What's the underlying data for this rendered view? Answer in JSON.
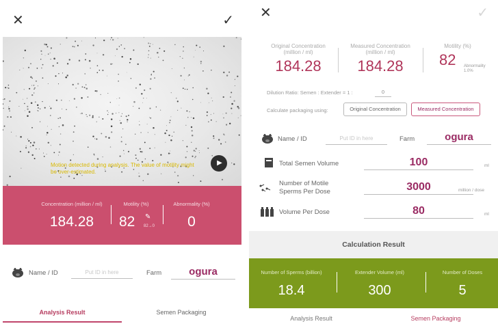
{
  "left": {
    "motion_warning": "Motion detected during analysis. The value of motility might be over-estimated.",
    "results": {
      "concentration_label": "Concentration (million / ml)",
      "concentration_value": "184.28",
      "motility_label": "Motility (%)",
      "motility_value": "82",
      "motility_sub": "82→0",
      "abnormality_label": "Abnormality (%)",
      "abnormality_value": "0"
    },
    "name_label": "Name / ID",
    "name_placeholder": "Put ID in here",
    "farm_label": "Farm",
    "farm_value": "ogura",
    "tabs": [
      "Analysis Result",
      "Semen Packaging"
    ]
  },
  "right": {
    "original_concentration_label": "Original Concentration (million / ml)",
    "original_concentration_value": "184.28",
    "measured_concentration_label": "Measured Concentration (million / ml)",
    "measured_concentration_value": "184.28",
    "motility_label": "Motility (%)",
    "motility_value": "82",
    "abnormality_small": "Abnormality 1.0%",
    "dilution_label": "Dilution Ratio: Semen : Extender = 1 :",
    "dilution_value": "0",
    "calc_using_label": "Calculate packaging using:",
    "option_original": "Original Concentration",
    "option_measured": "Measured Concentration",
    "name_label": "Name / ID",
    "name_placeholder": "Put ID in here",
    "farm_label": "Farm",
    "farm_value": "ogura",
    "total_volume_label": "Total Semen Volume",
    "total_volume_value": "100",
    "total_volume_unit": "ml",
    "motile_sperms_label_1": "Number of Motile",
    "motile_sperms_label_2": "Sperms Per Dose",
    "motile_sperms_value": "3000",
    "motile_sperms_unit": "million / dose",
    "volume_per_dose_label": "Volume Per Dose",
    "volume_per_dose_value": "80",
    "volume_per_dose_unit": "ml",
    "calc_result_header": "Calculation Result",
    "sperms_label": "Number of Sperms (billion)",
    "sperms_value": "18.4",
    "extender_label": "Extender Volume (ml)",
    "extender_value": "300",
    "doses_label": "Number of Doses",
    "doses_value": "5",
    "tabs": [
      "Analysis Result",
      "Semen Packaging"
    ]
  },
  "colors": {
    "result_band": "#cb4f6e",
    "accent_text": "#9a2b63",
    "green_band": "#7c9a1c",
    "warning": "#d8b800"
  },
  "icons": [
    "close-icon",
    "check-icon",
    "play-icon",
    "pig-icon",
    "beaker-icon",
    "sperm-icon",
    "vials-icon",
    "pen-icon"
  ]
}
